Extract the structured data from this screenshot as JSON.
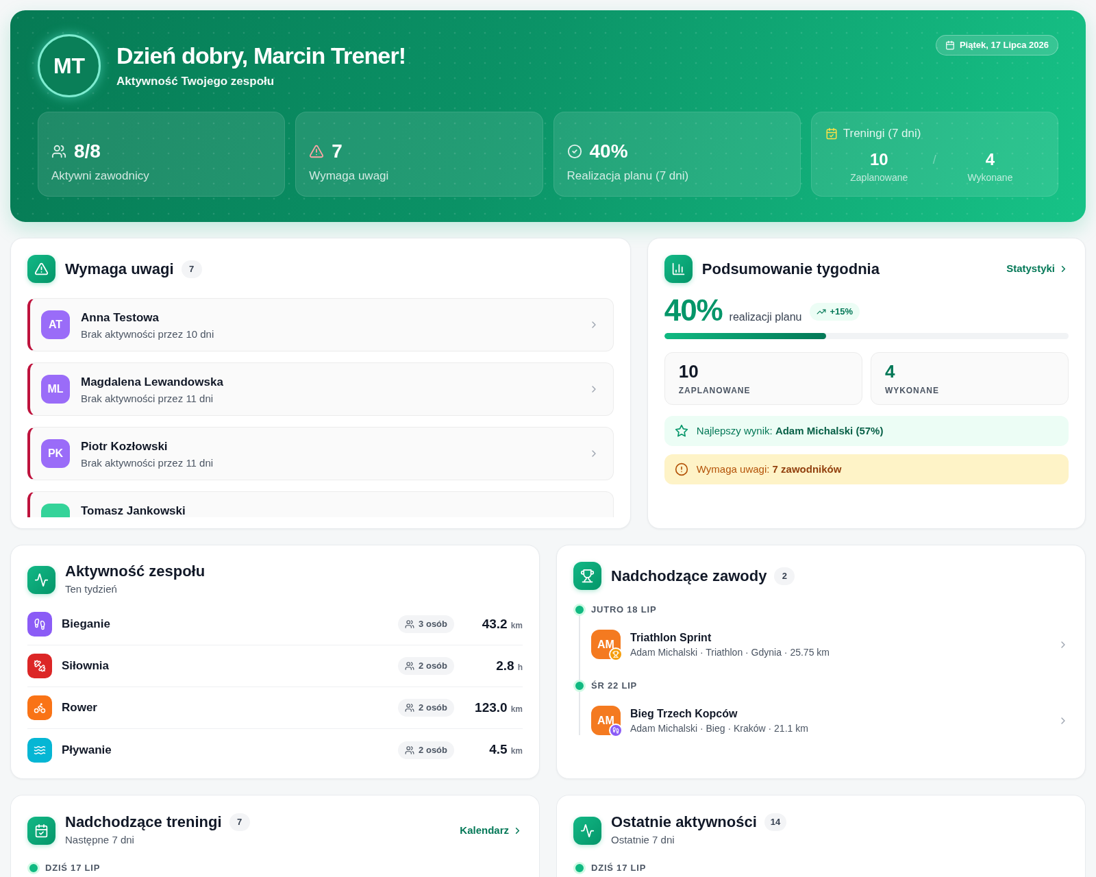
{
  "header": {
    "initials": "MT",
    "greeting": "Dzień dobry, Marcin Trener!",
    "subtitle": "Aktywność Twojego zespołu",
    "date": "Piątek, 17 Lipca 2026",
    "stats": [
      {
        "kind": "athletes",
        "value": "8/8",
        "label": "Aktywni zawodnicy"
      },
      {
        "kind": "alerts",
        "value": "7",
        "label": "Wymaga uwagi"
      },
      {
        "kind": "completion",
        "value": "40%",
        "label": "Realizacja planu (7 dni)"
      },
      {
        "kind": "trainings",
        "title": "Treningi (7 dni)",
        "separator": "/",
        "parts": [
          {
            "value": "10",
            "label": "Zaplanowane"
          },
          {
            "value": "4",
            "label": "Wykonane"
          }
        ]
      }
    ]
  },
  "attention": {
    "title": "Wymaga uwagi",
    "count": "7",
    "items": [
      {
        "initials": "AT",
        "name": "Anna Testowa",
        "detail": "Brak aktywności przez 10 dni",
        "color": "#9a6cf8"
      },
      {
        "initials": "ML",
        "name": "Magdalena Lewandowska",
        "detail": "Brak aktywności przez 11 dni",
        "color": "#9a6cf8"
      },
      {
        "initials": "PK",
        "name": "Piotr Kozłowski",
        "detail": "Brak aktywności przez 11 dni",
        "color": "#9a6cf8"
      },
      {
        "name": "Tomasz Jankowski",
        "color": "#34d399"
      }
    ]
  },
  "week_summary": {
    "title": "Podsumowanie tygodnia",
    "link": "Statystyki",
    "percent": "40%",
    "percent_label": "realizacji planu",
    "trend": "+15%",
    "level": 0.4,
    "stats": [
      {
        "kind": "planned",
        "value": "10",
        "label": "ZAPLANOWANE"
      },
      {
        "kind": "done",
        "value": "4",
        "label": "WYKONANE"
      }
    ],
    "notes": [
      {
        "kind": "best",
        "text": "Najlepszy wynik: **Adam Michalski (57%)**"
      },
      {
        "kind": "warning",
        "text": "Wymaga uwagi: **7 zawodników**"
      }
    ]
  },
  "team_activity": {
    "title": "Aktywność zespołu",
    "subtitle": "Ten tydzień",
    "rows": [
      {
        "kind": "running",
        "color": "#8b5cf6",
        "name": "Bieganie",
        "people": "3 osób",
        "value": "43.2",
        "unit": "km"
      },
      {
        "kind": "gym",
        "color": "#dc2626",
        "name": "Siłownia",
        "people": "2 osób",
        "value": "2.8",
        "unit": "h"
      },
      {
        "kind": "cycling",
        "color": "#f97316",
        "name": "Rower",
        "people": "2 osób",
        "value": "123.0",
        "unit": "km"
      },
      {
        "kind": "swimming",
        "color": "#06b6d4",
        "name": "Pływanie",
        "people": "2 osób",
        "value": "4.5",
        "unit": "km"
      }
    ]
  },
  "competitions": {
    "title": "Nadchodzące zawody",
    "count": "2",
    "groups": [
      {
        "date": "JUTRO 18 LIP",
        "events": [
          {
            "initials": "AM",
            "kind": "triathlon",
            "color": "#f59e0b",
            "title": "Triathlon Sprint",
            "details": "Adam Michalski · Triathlon · Gdynia · 25.75 km"
          }
        ]
      },
      {
        "date": "ŚR 22 LIP",
        "events": [
          {
            "initials": "AM",
            "kind": "running",
            "color": "#8b5cf6",
            "title": "Bieg Trzech Kopców",
            "details": "Adam Michalski · Bieg · Kraków · 21.1 km"
          }
        ]
      }
    ]
  },
  "trainings": {
    "title": "Nadchodzące treningi",
    "count": "7",
    "subtitle": "Następne 7 dni",
    "link": "Kalendarz",
    "dates": [
      "DZIŚ 17 LIP"
    ]
  },
  "recent_activities": {
    "title": "Ostatnie aktywności",
    "count": "14",
    "subtitle": "Ostatnie 7 dni",
    "dates": [
      "DZIŚ 17 LIP"
    ]
  }
}
